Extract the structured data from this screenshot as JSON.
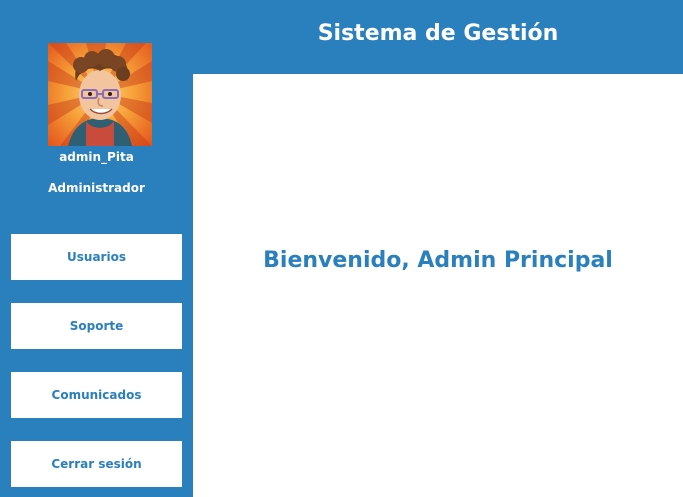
{
  "header": {
    "title": "Sistema de Gestión"
  },
  "sidebar": {
    "username": "admin_Pita",
    "role": "Administrador",
    "buttons": [
      {
        "label": "Usuarios"
      },
      {
        "label": "Soporte"
      },
      {
        "label": "Comunicados"
      },
      {
        "label": "Cerrar sesión"
      }
    ]
  },
  "main": {
    "welcome": "Bienvenido, Admin Principal"
  },
  "colors": {
    "primary": "#2a7fbd",
    "background": "#ffffff",
    "button_background": "#ffffff",
    "avatar_background": "#f08a1f"
  },
  "icons": {
    "avatar": "user-avatar-icon"
  }
}
